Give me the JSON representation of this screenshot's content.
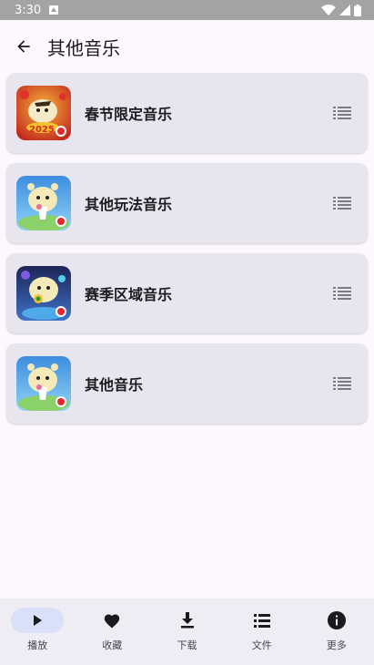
{
  "status_bar": {
    "time": "3:30"
  },
  "header": {
    "title": "其他音乐"
  },
  "categories": [
    {
      "title": "春节限定音乐"
    },
    {
      "title": "其他玩法音乐"
    },
    {
      "title": "赛季区域音乐"
    },
    {
      "title": "其他音乐"
    }
  ],
  "bottom_nav": [
    {
      "label": "播放",
      "icon": "play-icon",
      "active": true
    },
    {
      "label": "收藏",
      "icon": "heart-icon",
      "active": false
    },
    {
      "label": "下载",
      "icon": "download-icon",
      "active": false
    },
    {
      "label": "文件",
      "icon": "list-icon",
      "active": false
    },
    {
      "label": "更多",
      "icon": "info-icon",
      "active": false
    }
  ],
  "colors": {
    "status_bar": "#a3a3a3",
    "background": "#fdf8fd",
    "card": "#e7e6ee",
    "nav_bar": "#efedf4",
    "nav_active_pill": "#d9e0f7"
  }
}
